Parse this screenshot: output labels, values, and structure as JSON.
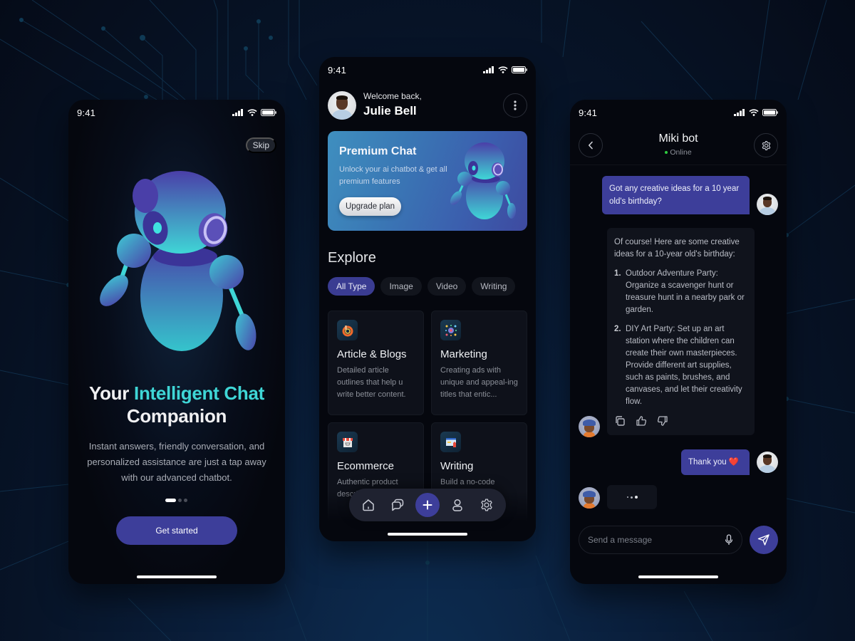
{
  "colors": {
    "accent": "#3d3e9a",
    "teal": "#3fd6d6",
    "online": "#2ecc40",
    "background": "#05070e"
  },
  "status_bar": {
    "time": "9:41"
  },
  "onboarding": {
    "skip_label": "Skip",
    "title_part1": "Your ",
    "title_accent": "Intelligent Chat",
    "title_part2": "Companion",
    "description": "Instant answers, friendly conversation, and personalized assistance are just a tap away with our advanced chatbot.",
    "page_indicator": {
      "current": 1,
      "total": 3
    },
    "cta_label": "Get started"
  },
  "home": {
    "greeting": "Welcome back,",
    "user_name": "Julie Bell",
    "premium": {
      "title": "Premium Chat",
      "description": "Unlock your ai chatbot & get all premium features",
      "button_label": "Upgrade plan"
    },
    "explore_title": "Explore",
    "filters": [
      {
        "label": "All Type",
        "active": true
      },
      {
        "label": "Image",
        "active": false
      },
      {
        "label": "Video",
        "active": false
      },
      {
        "label": "Writing",
        "active": false
      }
    ],
    "cards": [
      {
        "icon": "article-icon",
        "title": "Article & Blogs",
        "description": "Detailed article outlines that help u write better content."
      },
      {
        "icon": "marketing-icon",
        "title": "Marketing",
        "description": "Creating ads with unique and appeal-ing titles that entic..."
      },
      {
        "icon": "ecommerce-icon",
        "title": "Ecommerce",
        "description": "Authentic product descriptions that will..."
      },
      {
        "icon": "writing-icon",
        "title": "Writing",
        "description": "Build a no-code writing chatbot"
      }
    ],
    "tabbar": [
      {
        "icon": "home-icon",
        "label": "Home"
      },
      {
        "icon": "chat-icon",
        "label": "Chats"
      },
      {
        "icon": "plus-icon",
        "label": "New"
      },
      {
        "icon": "user-icon",
        "label": "Profile"
      },
      {
        "icon": "gear-icon",
        "label": "Settings"
      }
    ]
  },
  "chat": {
    "bot_name": "Miki bot",
    "bot_status": "Online",
    "messages": [
      {
        "from": "user",
        "text": "Got any creative ideas for a 10 year old's birthday?"
      },
      {
        "from": "bot",
        "intro": "Of course! Here are some creative ideas for a 10-year old's birthday:",
        "items": [
          {
            "num": "1.",
            "text": "Outdoor Adventure Party: Organize a scavenger hunt or treasure hunt in a nearby park or garden."
          },
          {
            "num": "2.",
            "text": "DIY Art Party: Set up an art station where the children can create their own masterpieces. Provide different art supplies, such as paints, brushes, and canvases, and let their creativity flow."
          }
        ]
      },
      {
        "from": "user",
        "text": "Thank you ❤️"
      },
      {
        "from": "bot",
        "typing": true
      }
    ],
    "input_placeholder": "Send a message"
  }
}
